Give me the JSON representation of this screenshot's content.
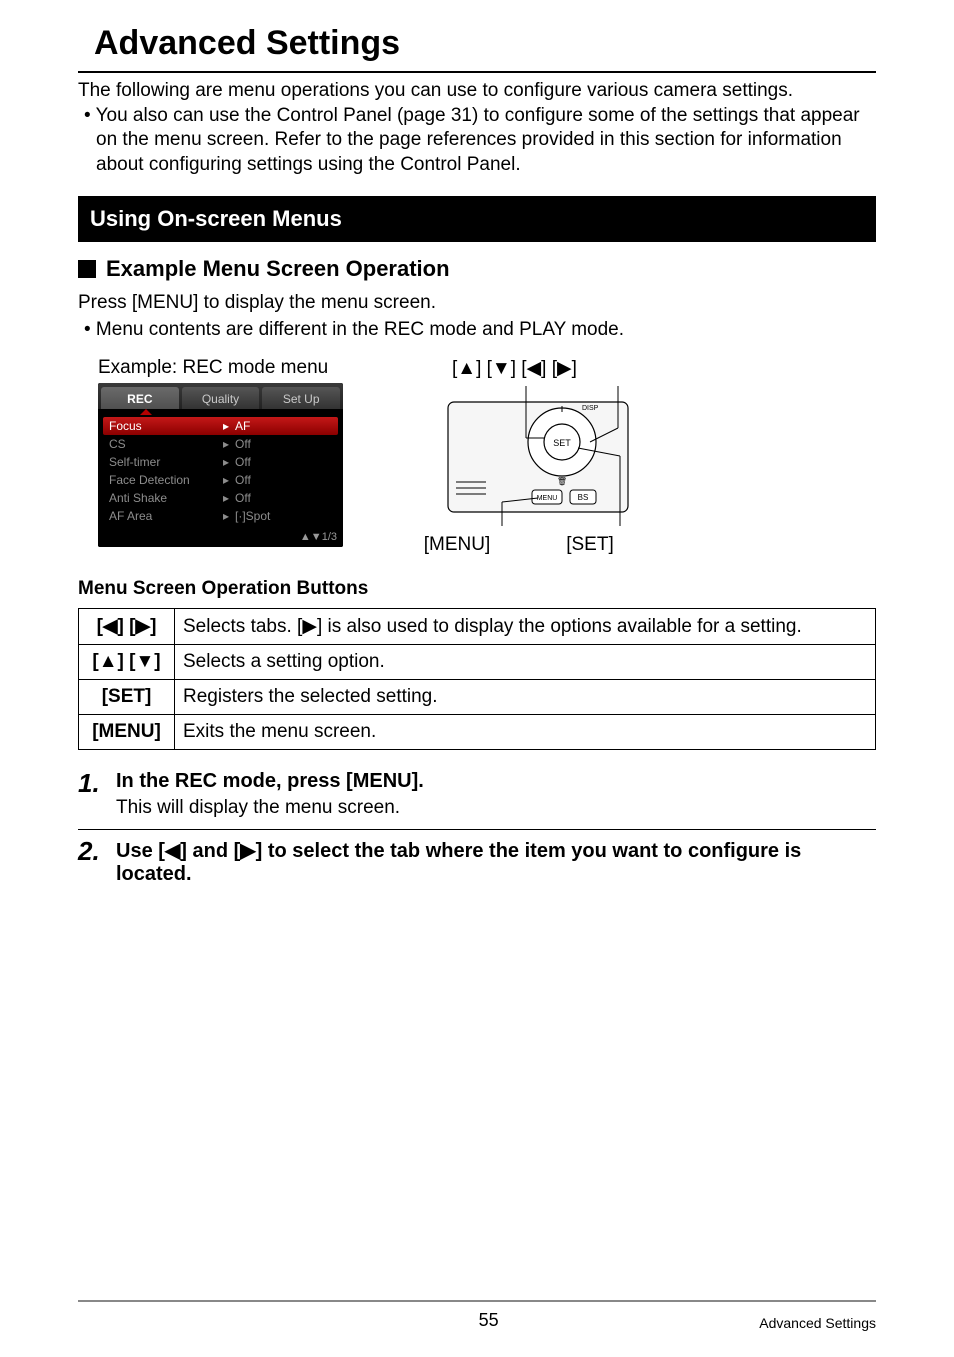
{
  "title": "Advanced Settings",
  "intro_line": "The following are menu operations you can use to configure various camera settings.",
  "intro_bullet": "•  You also can use the Control Panel (page 31) to configure some of the settings that appear on the menu screen. Refer to the page references provided in this section for information about configuring settings using the Control Panel.",
  "section_bar": "Using On-screen Menus",
  "subhead": "Example Menu Screen Operation",
  "press_menu": "Press [MENU] to display the menu screen.",
  "contents_bullet": "•  Menu contents are different in the REC mode and PLAY mode.",
  "example_label": "Example: REC mode menu",
  "arrows_label": "[▲] [▼] [◀] [▶]",
  "diagram_menu": "[MENU]",
  "diagram_set": "[SET]",
  "menu_shot": {
    "tabs": [
      "REC",
      "Quality",
      "Set Up"
    ],
    "rows": [
      {
        "label": "Focus",
        "value": "AF",
        "selected": true
      },
      {
        "label": "CS",
        "value": "Off"
      },
      {
        "label": "Self-timer",
        "value": "Off"
      },
      {
        "label": "Face Detection",
        "value": "Off"
      },
      {
        "label": "Anti Shake",
        "value": "Off"
      },
      {
        "label": "AF Area",
        "value": "[·]Spot"
      }
    ],
    "footer": "▲▼1/3"
  },
  "table_title": "Menu Screen Operation Buttons",
  "ops_table": [
    {
      "key": "[◀] [▶]",
      "desc": "Selects tabs. [▶] is also used to display the options available for a setting."
    },
    {
      "key": "[▲] [▼]",
      "desc": "Selects a setting option."
    },
    {
      "key": "[SET]",
      "desc": "Registers the selected setting."
    },
    {
      "key": "[MENU]",
      "desc": "Exits the menu screen."
    }
  ],
  "steps": [
    {
      "num": "1.",
      "text": "In the REC mode, press [MENU].",
      "sub": "This will display the menu screen."
    },
    {
      "num": "2.",
      "text": "Use [◀] and [▶] to select the tab where the item you want to configure is located.",
      "sub": ""
    }
  ],
  "page_number": "55",
  "footer_right": "Advanced Settings",
  "diagram_svg_labels": {
    "disp": "DISP",
    "set": "SET",
    "menu": "MENU",
    "bs": "BS",
    "trash": "⌫"
  }
}
